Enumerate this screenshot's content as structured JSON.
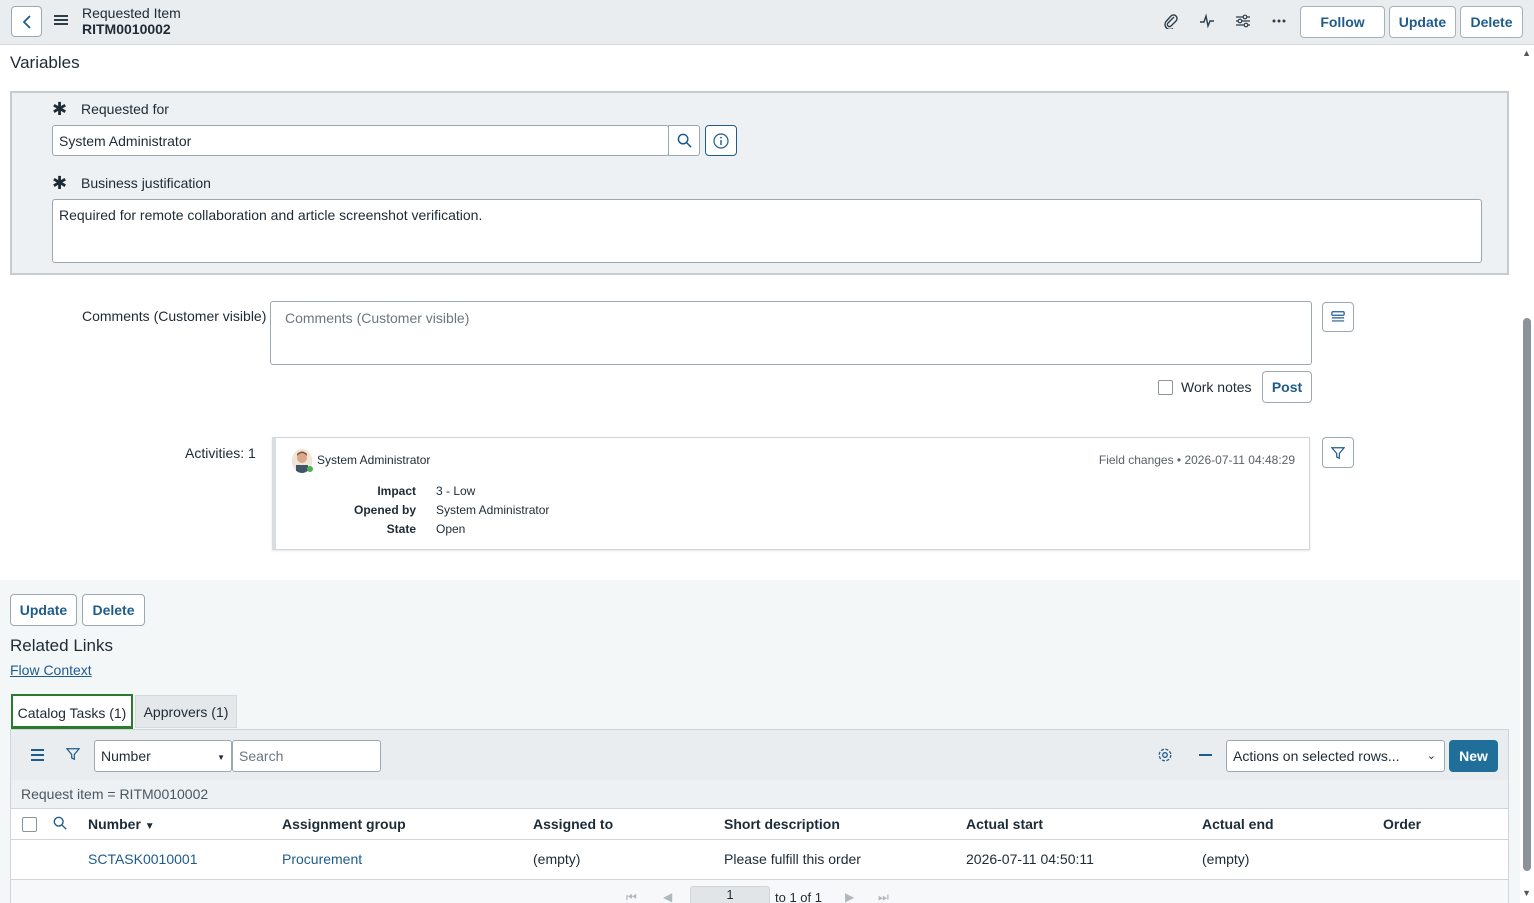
{
  "header": {
    "title_line1": "Requested Item",
    "title_line2": "RITM0010002",
    "follow_label": "Follow",
    "update_label": "Update",
    "delete_label": "Delete"
  },
  "variables": {
    "heading": "Variables",
    "requested_for_label": "Requested for",
    "requested_for_value": "System Administrator",
    "business_justification_label": "Business justification",
    "business_justification_value": "Required for remote collaboration and article screenshot verification."
  },
  "comments": {
    "label": "Comments (Customer visible)",
    "placeholder": "Comments (Customer visible)",
    "work_notes_label": "Work notes",
    "post_label": "Post"
  },
  "activities": {
    "label": "Activities: 1",
    "user": "System Administrator",
    "meta": "Field changes  •  2026-07-11 04:48:29",
    "rows": [
      {
        "key": "Impact",
        "value": "3 - Low"
      },
      {
        "key": "Opened by",
        "value": "System Administrator"
      },
      {
        "key": "State",
        "value": "Open"
      }
    ]
  },
  "bottom": {
    "update_label": "Update",
    "delete_label": "Delete",
    "related_links_heading": "Related Links",
    "flow_context_link": "Flow Context"
  },
  "tabs": [
    {
      "label": "Catalog Tasks (1)",
      "active": true
    },
    {
      "label": "Approvers (1)",
      "active": false
    }
  ],
  "list": {
    "field_select": "Number",
    "search_placeholder": "Search",
    "actions_select": "Actions on selected rows...",
    "new_label": "New",
    "breadcrumb": "Request item = RITM0010002",
    "columns": [
      "Number",
      "Assignment group",
      "Assigned to",
      "Short description",
      "Actual start",
      "Actual end",
      "Order"
    ],
    "rows": [
      [
        "SCTASK0010001",
        "Procurement",
        "(empty)",
        "Please fulfill this order",
        "2026-07-11 04:50:11",
        "(empty)",
        ""
      ]
    ],
    "pager_page": "1",
    "pager_text": "to 1 of 1"
  },
  "colors": {
    "accent": "#1f5c8c",
    "primary_button": "#1f6f9a",
    "active_tab_border": "#2c7a2c"
  }
}
